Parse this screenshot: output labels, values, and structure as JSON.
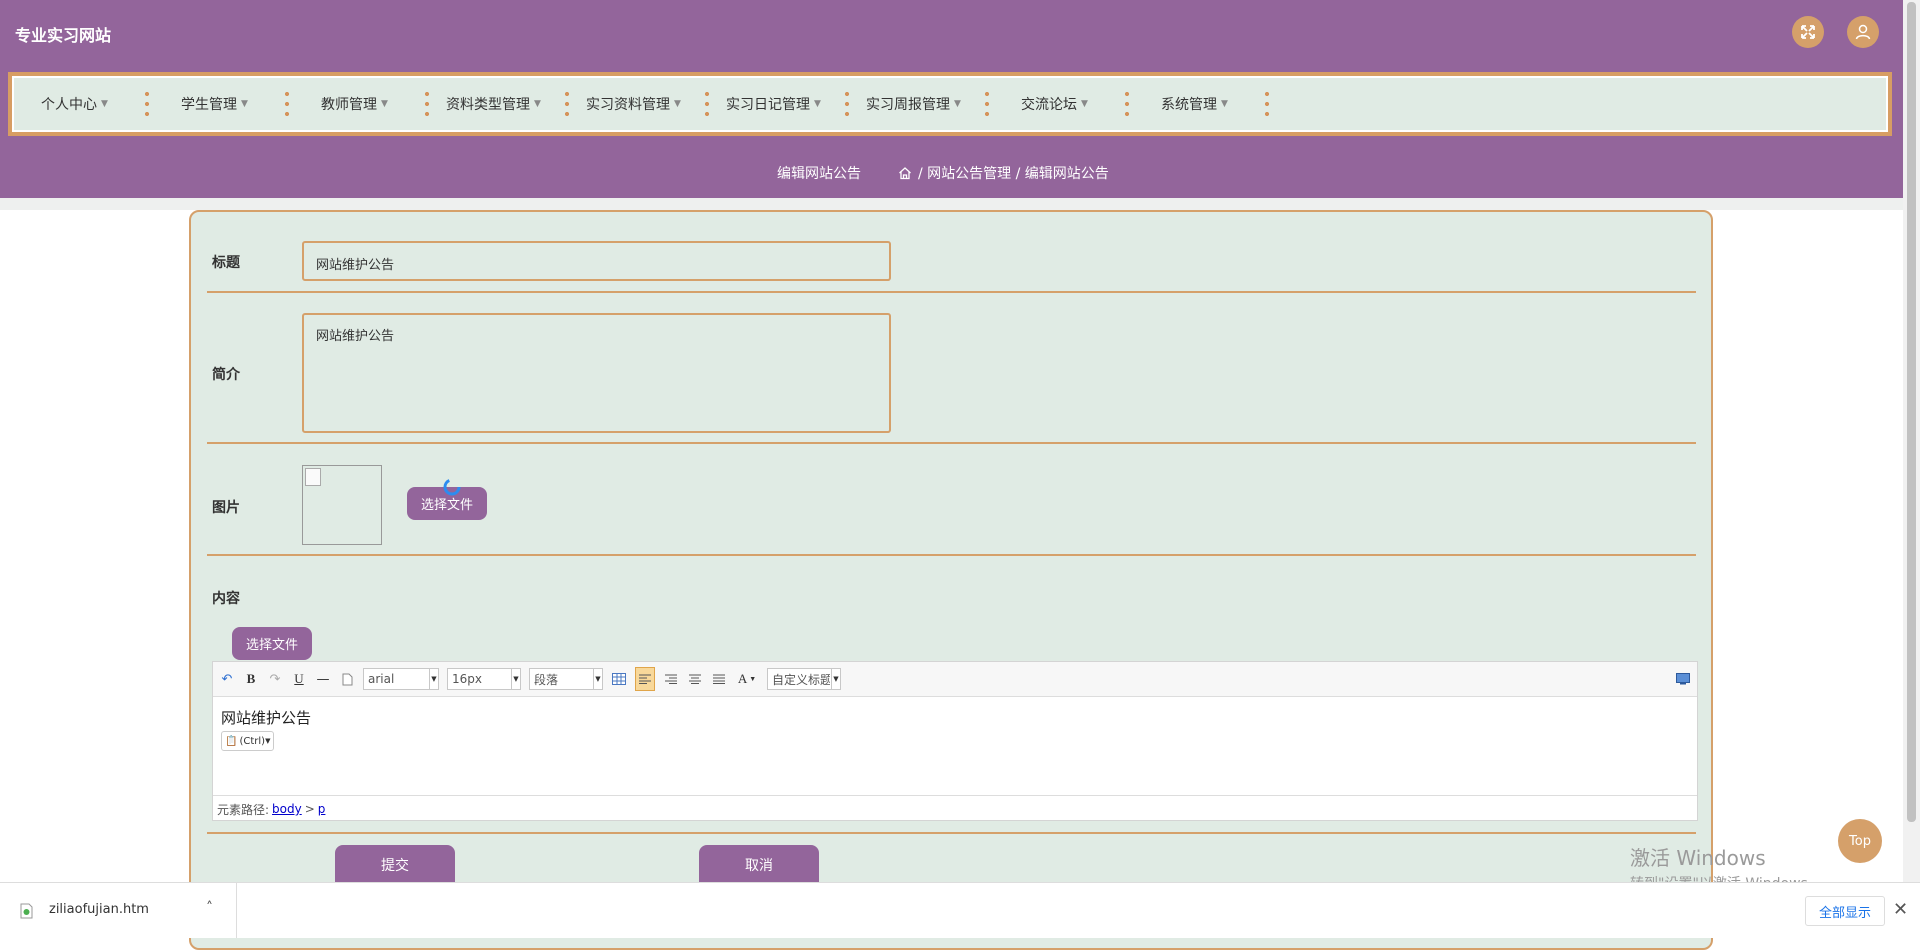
{
  "header": {
    "site_title": "专业实习网站",
    "fullscreen_icon": "expand-icon",
    "user_icon": "user-icon"
  },
  "nav": {
    "items": [
      {
        "label": "个人中心"
      },
      {
        "label": "学生管理"
      },
      {
        "label": "教师管理"
      },
      {
        "label": "资料类型管理"
      },
      {
        "label": "实习资料管理"
      },
      {
        "label": "实习日记管理"
      },
      {
        "label": "实习周报管理"
      },
      {
        "label": "交流论坛"
      },
      {
        "label": "系统管理"
      }
    ]
  },
  "breadcrumb": {
    "page_title": "编辑网站公告",
    "home_icon": "home-icon",
    "path": "/ 网站公告管理 / 编辑网站公告"
  },
  "form": {
    "title_label": "标题",
    "title_value": "网站维护公告",
    "intro_label": "简介",
    "intro_value": "网站维护公告",
    "image_label": "图片",
    "image_button": "选择文件",
    "content_label": "内容",
    "content_button": "选择文件"
  },
  "editor": {
    "font_family": "arial",
    "font_size": "16px",
    "paragraph": "段落",
    "custom_title": "自定义标题",
    "body_text": "网站维护公告",
    "paste_chip": "(Ctrl)",
    "element_path_label": "元素路径:",
    "path_body": "body",
    "path_sep": ">",
    "path_p": "p"
  },
  "actions": {
    "submit": "提交",
    "cancel": "取消"
  },
  "top_button": "Top",
  "watermark": {
    "line1": "激活 Windows",
    "line2": "转到\"设置\"以激活 Windows。"
  },
  "download_bar": {
    "file_name": "ziliaofujian.htm",
    "show_all": "全部显示"
  },
  "colors": {
    "primary": "#93659b",
    "accent": "#d5a06a",
    "panel": "#e0ebe4"
  }
}
